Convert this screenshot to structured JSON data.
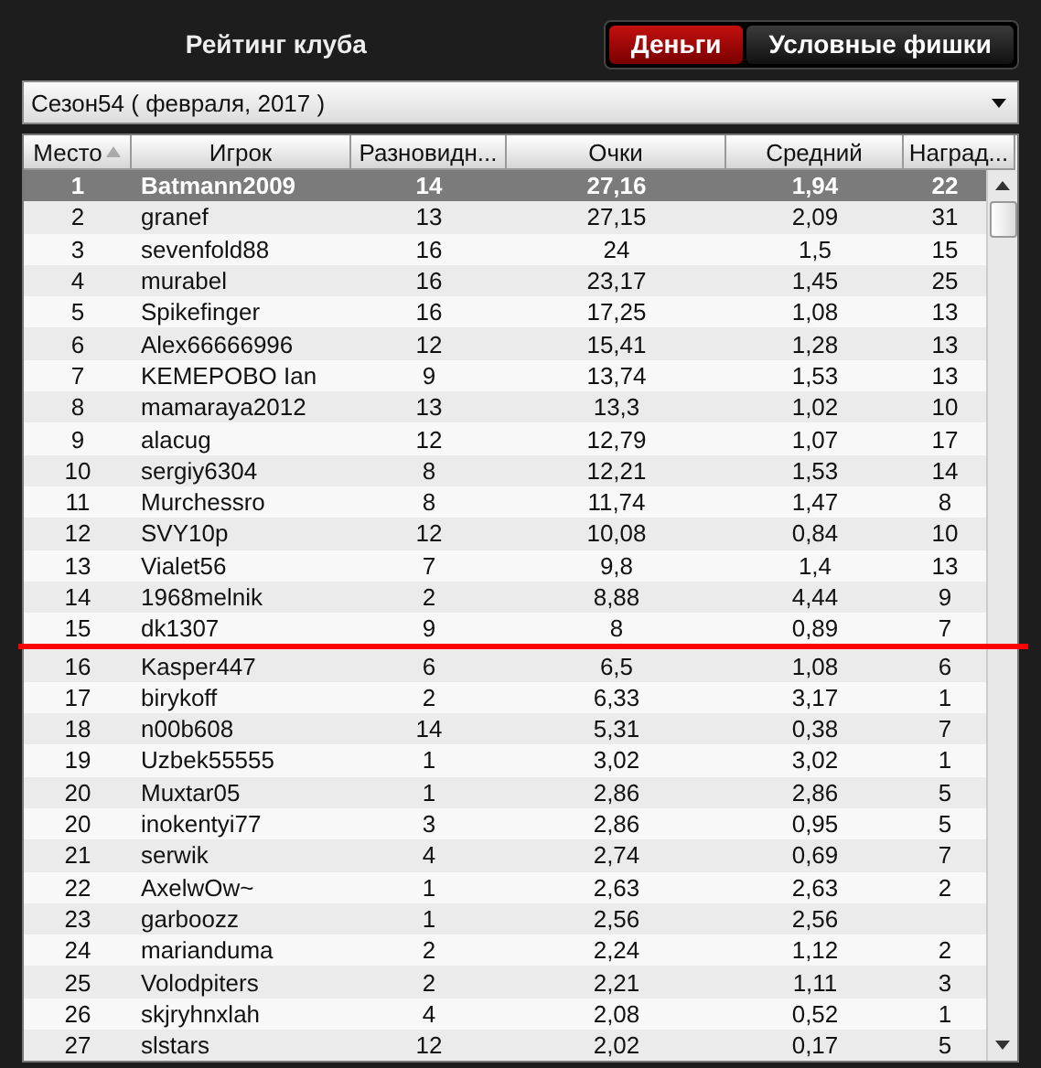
{
  "title": "Рейтинг клуба",
  "tabs": [
    {
      "label": "Деньги",
      "selected": true
    },
    {
      "label": "Условные фишки",
      "selected": false
    }
  ],
  "season": {
    "value": "Сезон54 ( февраля, 2017 )"
  },
  "table": {
    "columns": [
      {
        "label": "Место",
        "sorted": true
      },
      {
        "label": "Игрок",
        "sorted": false
      },
      {
        "label": "Разновидн...",
        "sorted": false
      },
      {
        "label": "Очки",
        "sorted": false
      },
      {
        "label": "Средний",
        "sorted": false
      },
      {
        "label": "Наград...",
        "sorted": false
      }
    ],
    "rows": [
      {
        "cells": [
          "1",
          "Batmann2009",
          "14",
          "27,16",
          "1,94",
          "22"
        ],
        "selected": true,
        "line_below": false
      },
      {
        "cells": [
          "2",
          "granef",
          "13",
          "27,15",
          "2,09",
          "31"
        ],
        "selected": false,
        "line_below": false
      },
      {
        "cells": [
          "3",
          "sevenfold88",
          "16",
          "24",
          "1,5",
          "15"
        ],
        "selected": false,
        "line_below": false
      },
      {
        "cells": [
          "4",
          "murabel",
          "16",
          "23,17",
          "1,45",
          "25"
        ],
        "selected": false,
        "line_below": false
      },
      {
        "cells": [
          "5",
          "Spikefinger",
          "16",
          "17,25",
          "1,08",
          "13"
        ],
        "selected": false,
        "line_below": false
      },
      {
        "cells": [
          "6",
          "Alex66666996",
          "12",
          "15,41",
          "1,28",
          "13"
        ],
        "selected": false,
        "line_below": false
      },
      {
        "cells": [
          "7",
          "KEMEPOBO Ian",
          "9",
          "13,74",
          "1,53",
          "13"
        ],
        "selected": false,
        "line_below": false
      },
      {
        "cells": [
          "8",
          "mamaraya2012",
          "13",
          "13,3",
          "1,02",
          "10"
        ],
        "selected": false,
        "line_below": false
      },
      {
        "cells": [
          "9",
          "alacug",
          "12",
          "12,79",
          "1,07",
          "17"
        ],
        "selected": false,
        "line_below": false
      },
      {
        "cells": [
          "10",
          "sergiy6304",
          "8",
          "12,21",
          "1,53",
          "14"
        ],
        "selected": false,
        "line_below": false
      },
      {
        "cells": [
          "11",
          "Murchessro",
          "8",
          "11,74",
          "1,47",
          "8"
        ],
        "selected": false,
        "line_below": false
      },
      {
        "cells": [
          "12",
          "SVY10p",
          "12",
          "10,08",
          "0,84",
          "10"
        ],
        "selected": false,
        "line_below": false
      },
      {
        "cells": [
          "13",
          "Vialet56",
          "7",
          "9,8",
          "1,4",
          "13"
        ],
        "selected": false,
        "line_below": false
      },
      {
        "cells": [
          "14",
          "1968melnik",
          "2",
          "8,88",
          "4,44",
          "9"
        ],
        "selected": false,
        "line_below": false
      },
      {
        "cells": [
          "15",
          "dk1307",
          "9",
          "8",
          "0,89",
          "7"
        ],
        "selected": false,
        "line_below": true
      },
      {
        "cells": [
          "16",
          "Kasper447",
          "6",
          "6,5",
          "1,08",
          "6"
        ],
        "selected": false,
        "line_below": false
      },
      {
        "cells": [
          "17",
          "birykoff",
          "2",
          "6,33",
          "3,17",
          "1"
        ],
        "selected": false,
        "line_below": false
      },
      {
        "cells": [
          "18",
          "n00b608",
          "14",
          "5,31",
          "0,38",
          "7"
        ],
        "selected": false,
        "line_below": false
      },
      {
        "cells": [
          "19",
          "Uzbek55555",
          "1",
          "3,02",
          "3,02",
          "1"
        ],
        "selected": false,
        "line_below": false
      },
      {
        "cells": [
          "20",
          "Muxtar05",
          "1",
          "2,86",
          "2,86",
          "5"
        ],
        "selected": false,
        "line_below": false
      },
      {
        "cells": [
          "20",
          "inokentyi77",
          "3",
          "2,86",
          "0,95",
          "5"
        ],
        "selected": false,
        "line_below": false
      },
      {
        "cells": [
          "21",
          "serwik",
          "4",
          "2,74",
          "0,69",
          "7"
        ],
        "selected": false,
        "line_below": false
      },
      {
        "cells": [
          "22",
          "AxelwOw~",
          "1",
          "2,63",
          "2,63",
          "2"
        ],
        "selected": false,
        "line_below": false
      },
      {
        "cells": [
          "23",
          "garboozz",
          "1",
          "2,56",
          "2,56",
          ""
        ],
        "selected": false,
        "line_below": false
      },
      {
        "cells": [
          "24",
          "marianduma",
          "2",
          "2,24",
          "1,12",
          "2"
        ],
        "selected": false,
        "line_below": false
      },
      {
        "cells": [
          "25",
          "Volodpiters",
          "2",
          "2,21",
          "1,11",
          "3"
        ],
        "selected": false,
        "line_below": false
      },
      {
        "cells": [
          "26",
          "skjryhnxlah",
          "4",
          "2,08",
          "0,52",
          "1"
        ],
        "selected": false,
        "line_below": false
      },
      {
        "cells": [
          "27",
          "slstars",
          "12",
          "2,02",
          "0,17",
          "5"
        ],
        "selected": false,
        "line_below": false
      }
    ]
  }
}
